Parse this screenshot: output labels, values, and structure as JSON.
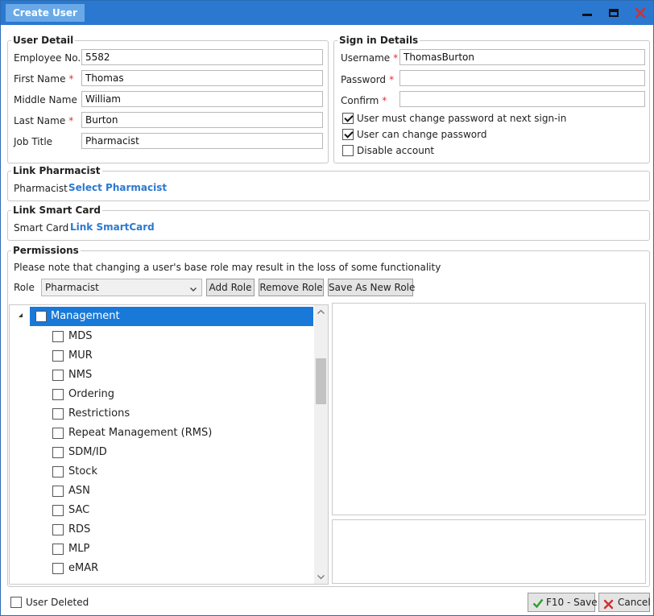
{
  "window": {
    "title": "Create User"
  },
  "user_detail": {
    "legend": "User Detail",
    "employee_no": {
      "label": "Employee No.",
      "value": "5582"
    },
    "first_name": {
      "label": "First Name",
      "required": "*",
      "value": "Thomas"
    },
    "middle_name": {
      "label": "Middle Name",
      "value": "William"
    },
    "last_name": {
      "label": "Last Name",
      "required": "*",
      "value": "Burton"
    },
    "job_title": {
      "label": "Job Title",
      "value": "Pharmacist"
    }
  },
  "sign_in": {
    "legend": "Sign in Details",
    "username": {
      "label": "Username",
      "required": "*",
      "value": "ThomasBurton"
    },
    "password": {
      "label": "Password",
      "required": "*",
      "value": ""
    },
    "confirm": {
      "label": "Confirm",
      "required": "*",
      "value": ""
    },
    "must_change": {
      "label": "User must change password at next sign-in",
      "checked": true
    },
    "can_change": {
      "label": "User can change password",
      "checked": true
    },
    "disable": {
      "label": "Disable account",
      "checked": false
    }
  },
  "link_pharmacist": {
    "legend": "Link Pharmacist",
    "label": "Pharmacist",
    "link": "Select Pharmacist"
  },
  "link_smartcard": {
    "legend": "Link Smart Card",
    "label": "Smart Card",
    "link": "Link SmartCard"
  },
  "permissions": {
    "legend": "Permissions",
    "note": "Please note that changing a user's base role may result in the loss of some functionality",
    "role_label": "Role",
    "role_value": "Pharmacist",
    "add_role": "Add Role",
    "remove_role": "Remove Role",
    "save_as_new_role": "Save As New Role",
    "tree": {
      "root": {
        "label": "Management",
        "checked": false,
        "selected": true
      },
      "children": [
        {
          "label": "MDS",
          "checked": false
        },
        {
          "label": "MUR",
          "checked": false
        },
        {
          "label": "NMS",
          "checked": false
        },
        {
          "label": "Ordering",
          "checked": false
        },
        {
          "label": "Restrictions",
          "checked": false
        },
        {
          "label": "Repeat Management (RMS)",
          "checked": false
        },
        {
          "label": "SDM/ID",
          "checked": false
        },
        {
          "label": "Stock",
          "checked": false
        },
        {
          "label": "ASN",
          "checked": false
        },
        {
          "label": "SAC",
          "checked": false
        },
        {
          "label": "RDS",
          "checked": false
        },
        {
          "label": "MLP",
          "checked": false
        },
        {
          "label": "eMAR",
          "checked": false
        }
      ]
    }
  },
  "footer": {
    "user_deleted": {
      "label": "User Deleted",
      "checked": false
    },
    "save": "F10 - Save",
    "cancel": "Cancel"
  },
  "colors": {
    "titlebar": "#2b78d1",
    "accent": "#1979d8",
    "link": "#2b78d1",
    "close": "#d33030",
    "save_check": "#2e9e2e"
  }
}
